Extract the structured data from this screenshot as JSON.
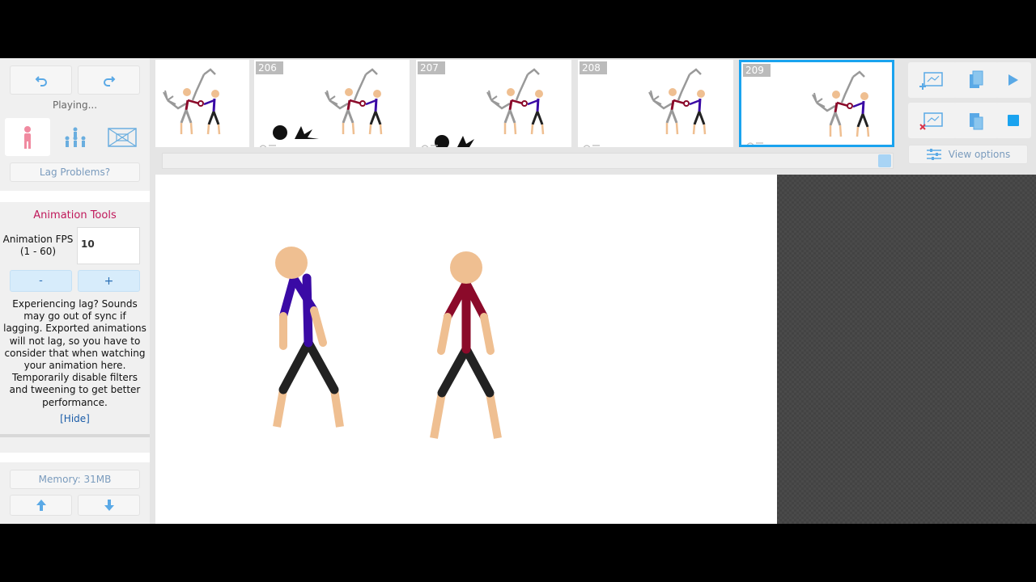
{
  "left_panel": {
    "status": "Playing...",
    "lag_button": "Lag Problems?",
    "animation_tools_title": "Animation Tools",
    "fps_label": "Animation FPS (1 - 60)",
    "fps_value": "10",
    "minus_label": "-",
    "plus_label": "+",
    "lag_text": "Experiencing lag? Sounds may go out of sync if lagging. Exported animations will not lag, so you have to consider that when watching your animation here. Temporarily disable filters and tweening to get better performance.",
    "hide_link": "[Hide]",
    "memory": "Memory: 31MB"
  },
  "timeline": {
    "frames": [
      {
        "number": ""
      },
      {
        "number": "206"
      },
      {
        "number": "207"
      },
      {
        "number": "208"
      },
      {
        "number": "209"
      }
    ],
    "selected_frame": "209"
  },
  "right_tools": {
    "view_options": "View options"
  },
  "colors": {
    "accent_blue": "#1aa3ef",
    "skin": "#efbf91",
    "purple": "#3a0aa5",
    "red": "#8b0a2a",
    "title_pink": "#c0185a"
  }
}
